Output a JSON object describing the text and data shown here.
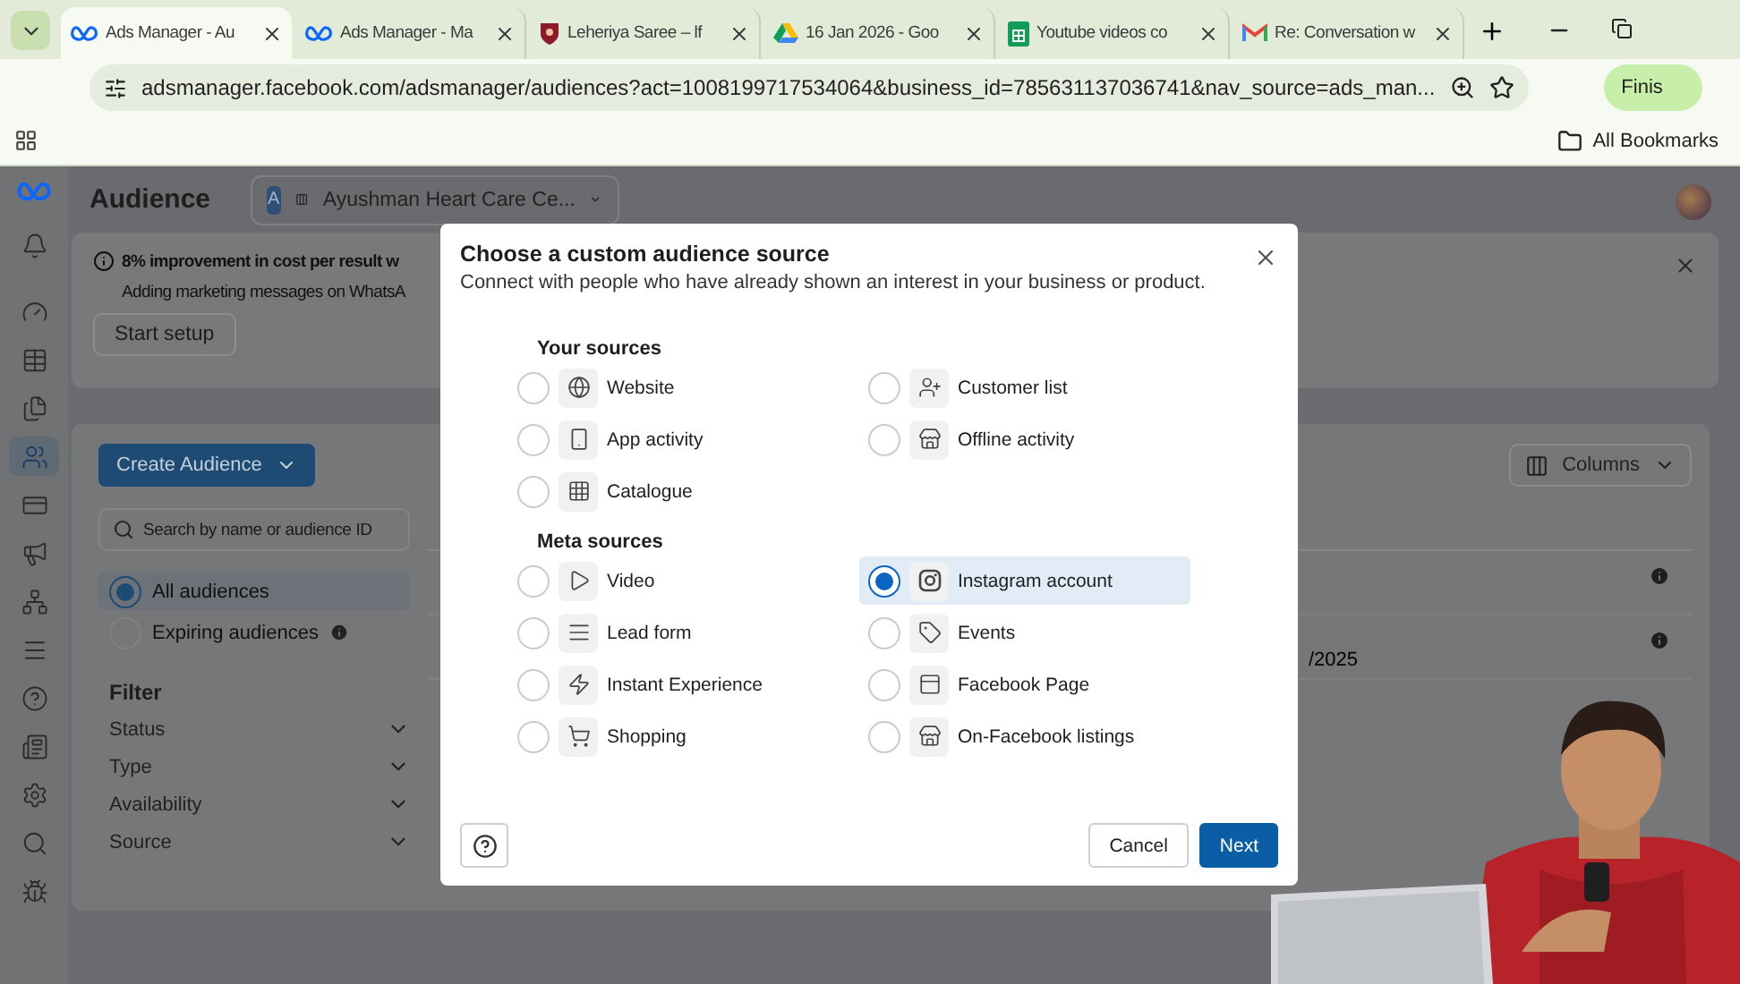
{
  "browser": {
    "tabs": [
      {
        "title": "Ads Manager - Au",
        "selected": true
      },
      {
        "title": "Ads Manager - Ma",
        "selected": false
      },
      {
        "title": "Leheriya Saree – lf",
        "selected": false
      },
      {
        "title": "16 Jan 2026 - Goo",
        "selected": false
      },
      {
        "title": "Youtube videos co",
        "selected": false
      },
      {
        "title": "Re: Conversation w",
        "selected": false
      }
    ],
    "address": "adsmanager.facebook.com/adsmanager/audiences?act=1008199717534064&business_id=785631137036741&nav_source=ads_man...",
    "profile_button": "Finis",
    "bookmarks": "All Bookmarks"
  },
  "nav": [
    {
      "selected": false
    },
    {
      "selected": false
    },
    {
      "selected": false
    },
    {
      "selected": false
    },
    {
      "selected": true
    },
    {
      "selected": false
    },
    {
      "selected": false
    },
    {
      "selected": false
    },
    {
      "selected": false
    },
    {
      "selected": false
    },
    {
      "selected": false
    },
    {
      "selected": false
    },
    {
      "selected": false
    },
    {
      "selected": false
    }
  ],
  "page": {
    "title": "Audience",
    "account_badge": "A",
    "account": "Ayushman Heart Care Ce...",
    "banner": {
      "title": "8% improvement in cost per result w",
      "text": "Adding marketing messages on WhatsA",
      "button": "Start setup"
    },
    "create_button": "Create Audience",
    "search": {
      "placeholder": "Search by name or audience ID"
    },
    "audience_filters": [
      {
        "label": "All audiences",
        "selected": true,
        "info": false
      },
      {
        "label": "Expiring audiences",
        "selected": false,
        "info": true
      }
    ],
    "filter": {
      "title": "Filter",
      "items": [
        "Status",
        "Type",
        "Availability",
        "Source"
      ]
    },
    "columns_button": "Columns",
    "table_rows": [
      {
        "kind": "blank"
      },
      {
        "kind": "dated",
        "column_1": "/2025"
      }
    ]
  },
  "modal": {
    "title": "Choose a custom audience source",
    "subtitle": "Connect with people who have already shown an interest in your business or product.",
    "sections": [
      {
        "heading": "Your sources",
        "options": [
          {
            "label": "Website",
            "selected": false
          },
          {
            "label": "Customer list",
            "selected": false
          },
          {
            "label": "App activity",
            "selected": false
          },
          {
            "label": "Offline activity",
            "selected": false
          },
          {
            "label": "Catalogue",
            "selected": false
          }
        ]
      },
      {
        "heading": "Meta sources",
        "options": [
          {
            "label": "Video",
            "selected": false
          },
          {
            "label": "Instagram account",
            "selected": true
          },
          {
            "label": "Lead form",
            "selected": false
          },
          {
            "label": "Events",
            "selected": false
          },
          {
            "label": "Instant Experience",
            "selected": false
          },
          {
            "label": "Facebook Page",
            "selected": false
          },
          {
            "label": "Shopping",
            "selected": false
          },
          {
            "label": "On-Facebook listings",
            "selected": false
          }
        ]
      }
    ],
    "cancel": "Cancel",
    "next": "Next"
  }
}
